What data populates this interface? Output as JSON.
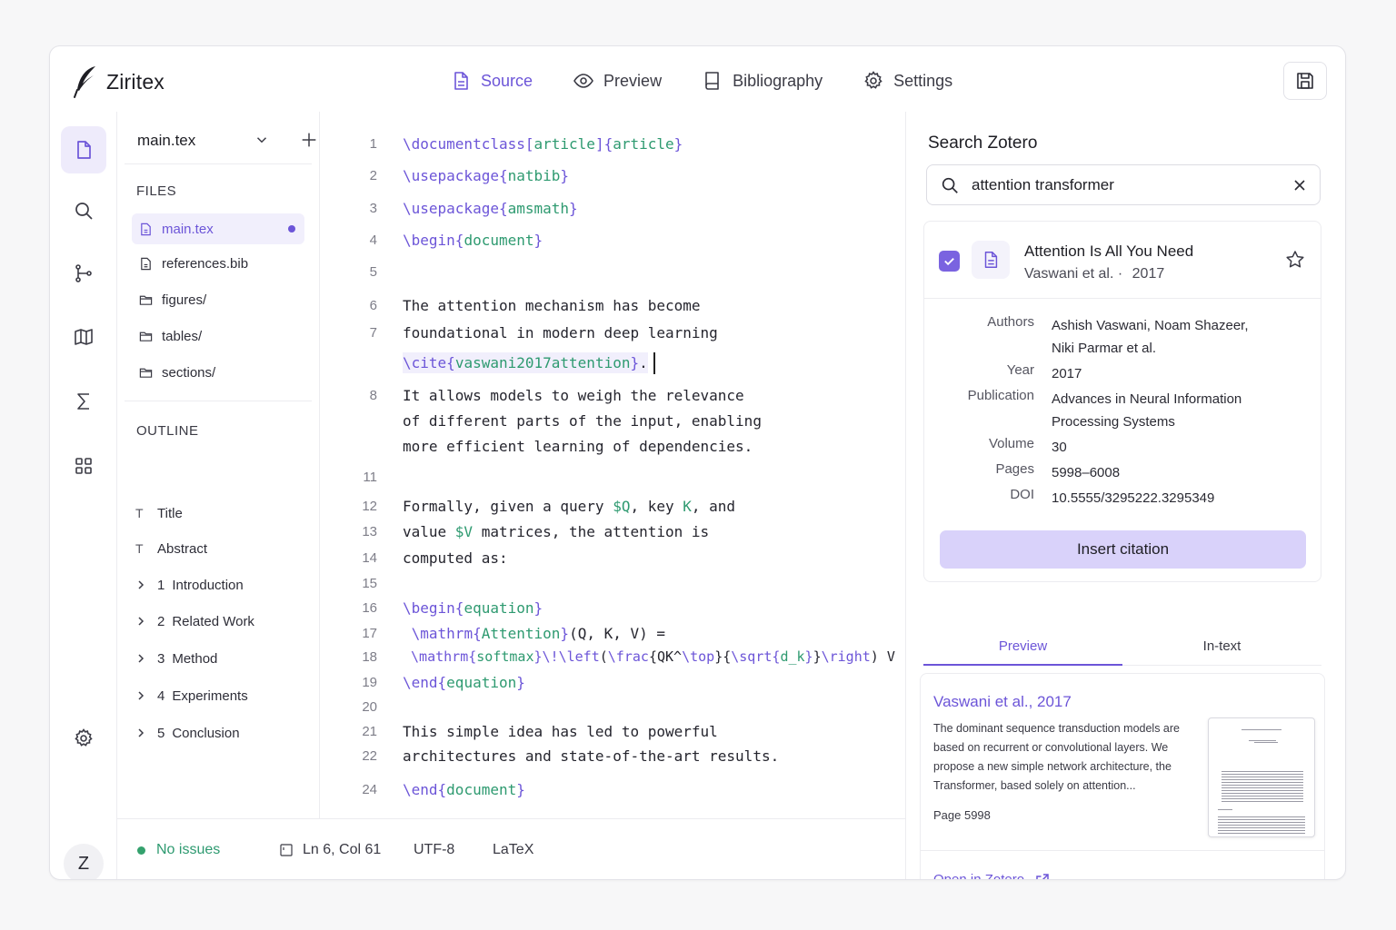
{
  "app": {
    "name": "Ziritex"
  },
  "tabs": [
    {
      "label": "Source",
      "icon": "file-icon",
      "active": true
    },
    {
      "label": "Preview",
      "icon": "eye-icon",
      "active": false
    },
    {
      "label": "Bibliography",
      "icon": "book-icon",
      "active": false
    },
    {
      "label": "Settings",
      "icon": "gear-icon",
      "active": false
    }
  ],
  "rail": {
    "items": [
      "files-icon",
      "search-icon",
      "git-icon",
      "map-icon",
      "sigma-icon",
      "grid-icon"
    ],
    "bottom": "settings-icon",
    "avatar": "Z"
  },
  "files": {
    "current": "main.tex",
    "section_title": "FILES",
    "items": [
      {
        "name": "main.tex",
        "type": "file",
        "active": true,
        "modified": true
      },
      {
        "name": "references.bib",
        "type": "file",
        "active": false
      },
      {
        "name": "figures/",
        "type": "folder",
        "active": false
      },
      {
        "name": "tables/",
        "type": "folder",
        "active": false
      },
      {
        "name": "sections/",
        "type": "folder",
        "active": false
      }
    ]
  },
  "outline": {
    "section_title": "OUTLINE",
    "items": [
      {
        "lead": "T",
        "label": "Title"
      },
      {
        "lead": "T",
        "label": "Abstract"
      },
      {
        "num": "1",
        "label": "Introduction"
      },
      {
        "num": "2",
        "label": "Related Work"
      },
      {
        "num": "3",
        "label": "Method"
      },
      {
        "num": "4",
        "label": "Experiments"
      },
      {
        "num": "5",
        "label": "Conclusion"
      }
    ]
  },
  "editor": {
    "lines": [
      {
        "n": "1",
        "text": "\\documentclass[article]{article}"
      },
      {
        "n": "2",
        "text": "\\usepackage{natbib}"
      },
      {
        "n": "3",
        "text": "\\usepackage{amsmath}"
      },
      {
        "n": "4",
        "text": "\\begin{document}"
      },
      {
        "n": "5",
        "text": ""
      },
      {
        "n": "6",
        "text": "The attention mechanism has become"
      },
      {
        "n": "7",
        "text": "foundational in modern deep learning"
      },
      {
        "n": "",
        "text": "\\cite{vaswani2017attention}."
      },
      {
        "n": "8",
        "text": "It allows models to weigh the relevance"
      },
      {
        "n": "",
        "text": "of different parts of the input, enabling"
      },
      {
        "n": "",
        "text": "more efficient learning of dependencies."
      },
      {
        "n": "11",
        "text": ""
      },
      {
        "n": "12",
        "text": "Formally, given a query $Q, key K, and"
      },
      {
        "n": "13",
        "text": "value $V matrices, the attention is"
      },
      {
        "n": "14",
        "text": "computed as:"
      },
      {
        "n": "15",
        "text": ""
      },
      {
        "n": "16",
        "text": "\\begin{equation}"
      },
      {
        "n": "17",
        "text": " \\mathrm{Attention}(Q, K, V) ="
      },
      {
        "n": "18",
        "text": " \\mathrm{softmax}\\!\\left(\\frac{QK^\\top}{\\sqrt{d_k}}\\right) V"
      },
      {
        "n": "19",
        "text": "\\end{equation}"
      },
      {
        "n": "20",
        "text": ""
      },
      {
        "n": "21",
        "text": "This simple idea has led to powerful"
      },
      {
        "n": "22",
        "text": "architectures and state-of-the-art results."
      },
      {
        "n": "24",
        "text": "\\end{document}"
      }
    ]
  },
  "status": {
    "issues": "No issues",
    "position": "Ln 6, Col 61",
    "encoding": "UTF-8",
    "language": "LaTeX"
  },
  "zotero": {
    "title": "Search Zotero",
    "query": "attention transformer",
    "result": {
      "title": "Attention Is All You Need",
      "authors_short": "Vaswani et al. ·",
      "year_short": "2017",
      "checked": true,
      "meta": [
        {
          "key": "Authors",
          "value": "Ashish Vaswani, Noam Shazeer, Niki Parmar et al."
        },
        {
          "key": "Year",
          "value": "2017"
        },
        {
          "key": "Publication",
          "value": "Advances in Neural Information Processing Systems"
        },
        {
          "key": "Volume",
          "value": "30"
        },
        {
          "key": "Pages",
          "value": "5998–6008"
        },
        {
          "key": "DOI",
          "value": "10.5555/3295222.3295349"
        }
      ],
      "insert_label": "Insert citation"
    },
    "preview_tabs": [
      {
        "label": "Preview",
        "active": true
      },
      {
        "label": "In-text",
        "active": false
      }
    ],
    "preview": {
      "citation": "Vaswani et al., 2017",
      "abstract": "The dominant sequence transduction models are based on recurrent or convolutional layers. We propose a new simple network architecture, the Transformer, based solely on attention...",
      "page": "Page 5998",
      "open_label": "Open in Zotero"
    }
  },
  "colors": {
    "accent": "#6c55d8",
    "accent_soft": "#d9d2fa",
    "latex_command": "#6c55d8",
    "latex_argument": "#2e9a70",
    "ok": "#34a16d"
  }
}
